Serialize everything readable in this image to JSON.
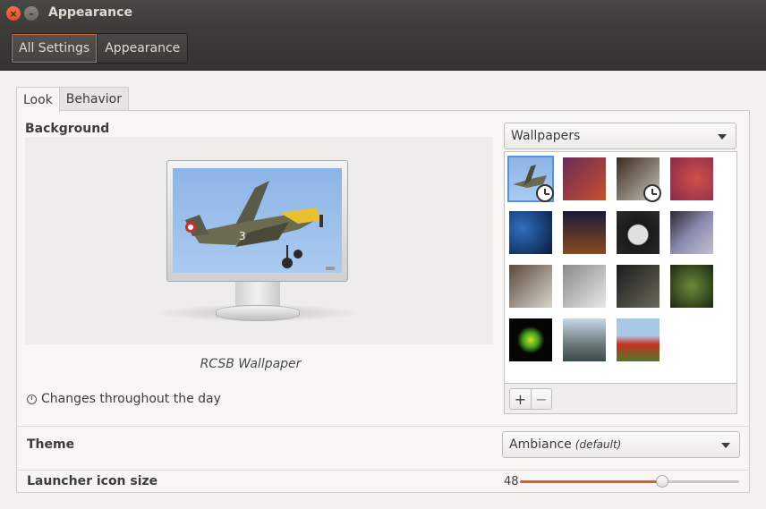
{
  "window": {
    "title": "Appearance"
  },
  "breadcrumbs": [
    "All Settings",
    "Appearance"
  ],
  "tabs": [
    "Look",
    "Behavior"
  ],
  "background": {
    "label": "Background",
    "wallpaper_name": "RCSB Wallpaper",
    "changes_text": "Changes throughout the day",
    "source_select": "Wallpapers",
    "add_label": "+",
    "remove_label": "−"
  },
  "theme": {
    "label": "Theme",
    "value": "Ambiance",
    "value_note": "(default)"
  },
  "launcher": {
    "label": "Launcher icon size",
    "value": "48",
    "slider_fraction": 0.65
  },
  "colors": {
    "accent": "#dd5b2c",
    "selection": "#5294e2"
  },
  "icons": {
    "close": "close-icon",
    "minimize": "minimize-icon",
    "clock": "clock-icon",
    "dropdown": "chevron-down-icon"
  }
}
